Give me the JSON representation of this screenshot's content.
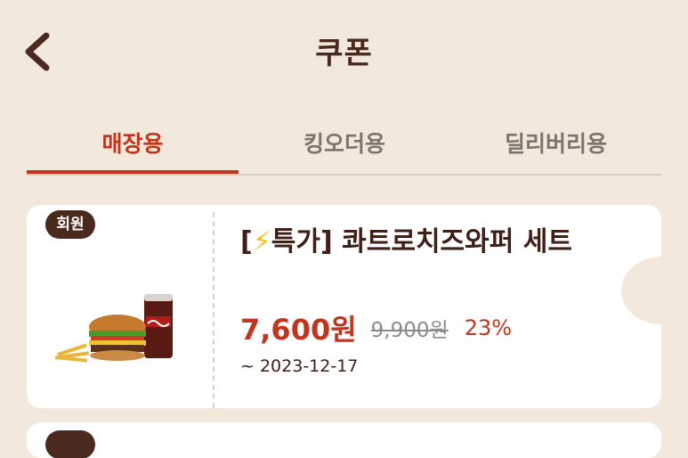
{
  "header": {
    "title": "쿠폰",
    "back_icon": "chevron-left-icon"
  },
  "tabs": [
    {
      "label": "매장용",
      "active": true
    },
    {
      "label": "킹오더용",
      "active": false
    },
    {
      "label": "딜리버리용",
      "active": false
    }
  ],
  "coupon": {
    "badge": "회원",
    "title_prefix": "[",
    "title_icon": "⚡",
    "title_rest": "특가] 콰트로치즈와퍼 세트",
    "sale_price": "7,600원",
    "original_price": "9,900원",
    "discount": "23%",
    "valid_until": "~ 2023-12-17",
    "image": "burger-set-image"
  },
  "colors": {
    "background": "#f2e8dc",
    "accent": "#c2351c",
    "brown": "#4a2a1f",
    "card": "#ffffff"
  }
}
